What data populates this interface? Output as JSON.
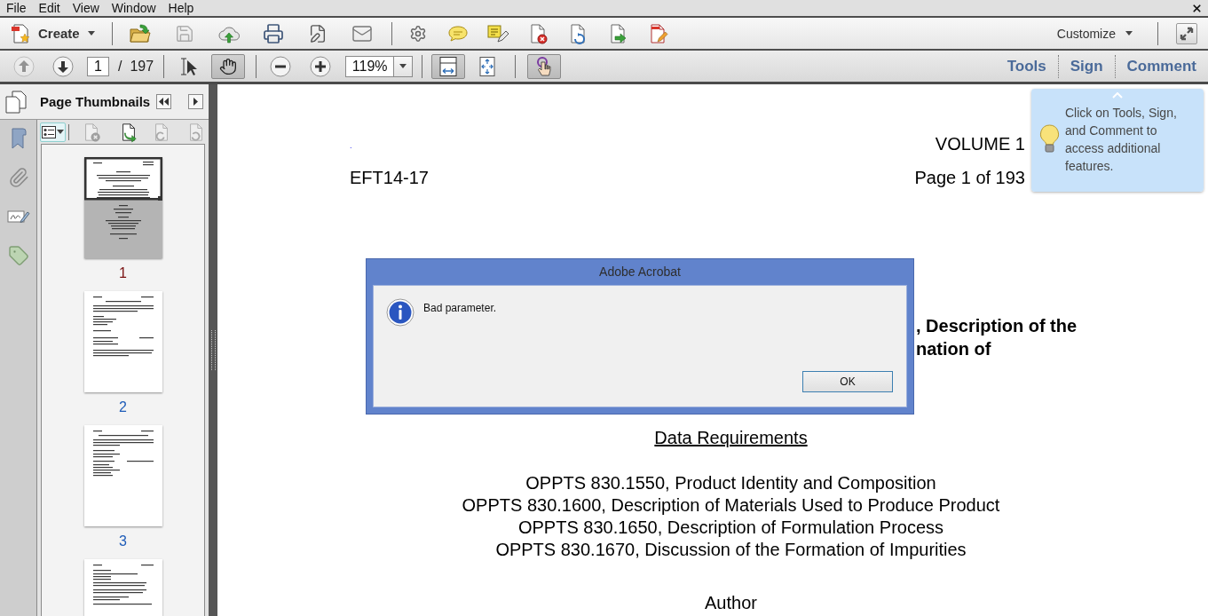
{
  "menu_bar": {
    "items": [
      "File",
      "Edit",
      "View",
      "Window",
      "Help"
    ]
  },
  "toolbar": {
    "create": "Create",
    "file_tools": [
      {
        "disabled": false
      },
      {
        "disabled": true
      },
      {
        "disabled": false
      },
      {
        "disabled": false
      },
      {
        "disabled": false
      },
      {
        "disabled": false
      }
    ],
    "quick_tools": [
      {
        "disabled": false
      },
      {
        "disabled": false
      },
      {
        "disabled": false
      },
      {
        "disabled": false
      },
      {
        "disabled": false
      },
      {
        "disabled": false
      },
      {
        "disabled": false
      }
    ],
    "customize": "Customize"
  },
  "navigation": {
    "previous_page": {
      "disabled": true
    },
    "next_page": {
      "disabled": false
    },
    "page_number": "1",
    "page_separator": "/",
    "page_count": "197",
    "view_tools": [
      {
        "selected": false
      },
      {
        "selected": true
      }
    ],
    "zoom_level": "119%",
    "layout_tools": [
      {
        "selected": true
      },
      {
        "selected": false
      }
    ],
    "read_mode": {
      "selected": true
    },
    "panes": [
      {
        "label": "Tools",
        "selected": false
      },
      {
        "label": "Sign",
        "selected": false
      },
      {
        "label": "Comment",
        "selected": false
      }
    ]
  },
  "sidebar": {
    "title": "Page Thumbnails",
    "panel_tools": [
      {
        "disabled": false
      },
      {
        "disabled": true
      },
      {
        "disabled": false
      },
      {
        "disabled": true
      },
      {
        "disabled": true
      }
    ],
    "thumbnails": [
      {
        "label": "1",
        "selected": true
      },
      {
        "label": "2",
        "selected": false
      },
      {
        "label": "3",
        "selected": false
      },
      {
        "selected": false
      }
    ]
  },
  "document": {
    "marker": ".",
    "volume": "VOLUME 1",
    "doc_id": "EFT14-17",
    "page_label": "Page 1 of 193",
    "title_lines": [
      ", Description of the",
      "nation of"
    ],
    "section_heading": "Data Requirements",
    "requirements": [
      "OPPTS 830.1550, Product Identity and Composition",
      "OPPTS 830.1600, Description of Materials Used to Produce Product",
      "OPPTS 830.1650, Description of Formulation Process",
      "OPPTS 830.1670, Discussion of the Formation of Impurities"
    ],
    "author_heading": "Author"
  },
  "tooltip": {
    "text": "Click on Tools, Sign, and Comment to access additional features."
  },
  "dialog": {
    "title": "Adobe Acrobat",
    "message": "Bad parameter.",
    "buttons": [
      {
        "label": "OK",
        "default": true
      }
    ]
  }
}
